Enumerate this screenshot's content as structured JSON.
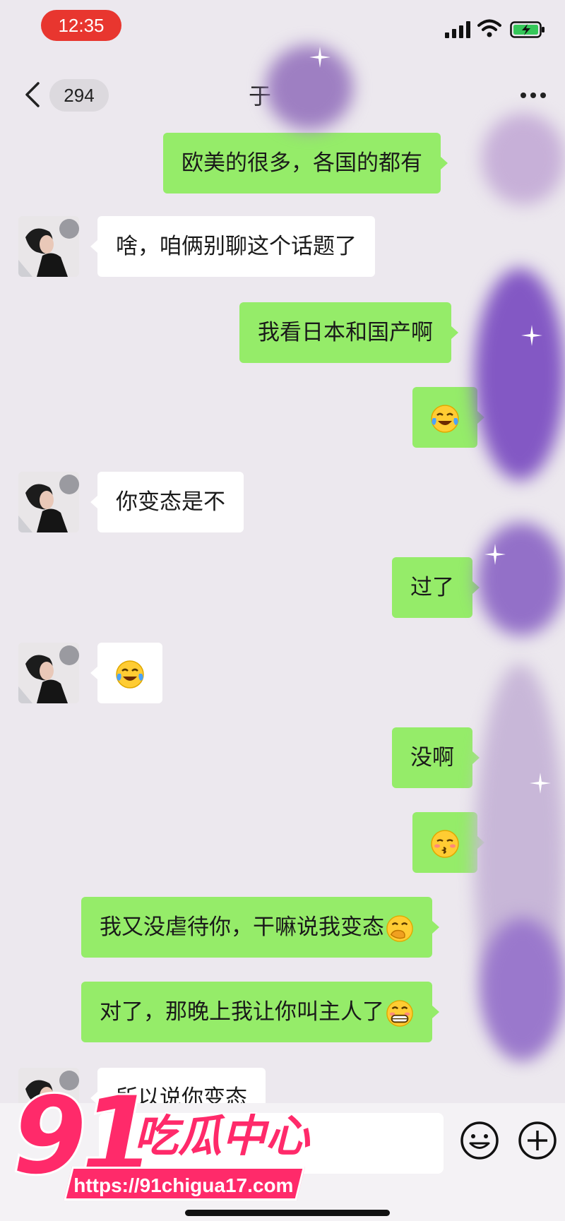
{
  "status_bar": {
    "time": "12:35"
  },
  "nav": {
    "unread_count": "294",
    "title_partial": "于"
  },
  "messages": [
    {
      "from": "me",
      "text": "欧美的很多，各国的都有"
    },
    {
      "from": "them",
      "text": "啥，咱俩别聊这个话题了"
    },
    {
      "from": "me",
      "text": "我看日本和国产啊"
    },
    {
      "from": "me",
      "emoji": "laughing-crying"
    },
    {
      "from": "them",
      "text": "你变态是不"
    },
    {
      "from": "me",
      "text": "过了"
    },
    {
      "from": "them",
      "emoji": "laughing-crying"
    },
    {
      "from": "me",
      "text": "没啊"
    },
    {
      "from": "me",
      "emoji": "kissing-face"
    },
    {
      "from": "me",
      "text": "我又没虐待你，干嘛说我变态",
      "trailing_emoji": "face-with-hand-over-mouth"
    },
    {
      "from": "me",
      "text": "对了，那晚上我让你叫主人了",
      "trailing_emoji": "grimacing-face"
    },
    {
      "from": "them",
      "text": "所以说你变态"
    }
  ],
  "watermark": {
    "number": "91",
    "name": "吃瓜中心",
    "url": "https://91chigua17.com"
  },
  "colors": {
    "my_bubble": "#95ec69",
    "their_bubble": "#ffffff",
    "background": "#ece8ee",
    "watermark": "#ff2a6a"
  }
}
